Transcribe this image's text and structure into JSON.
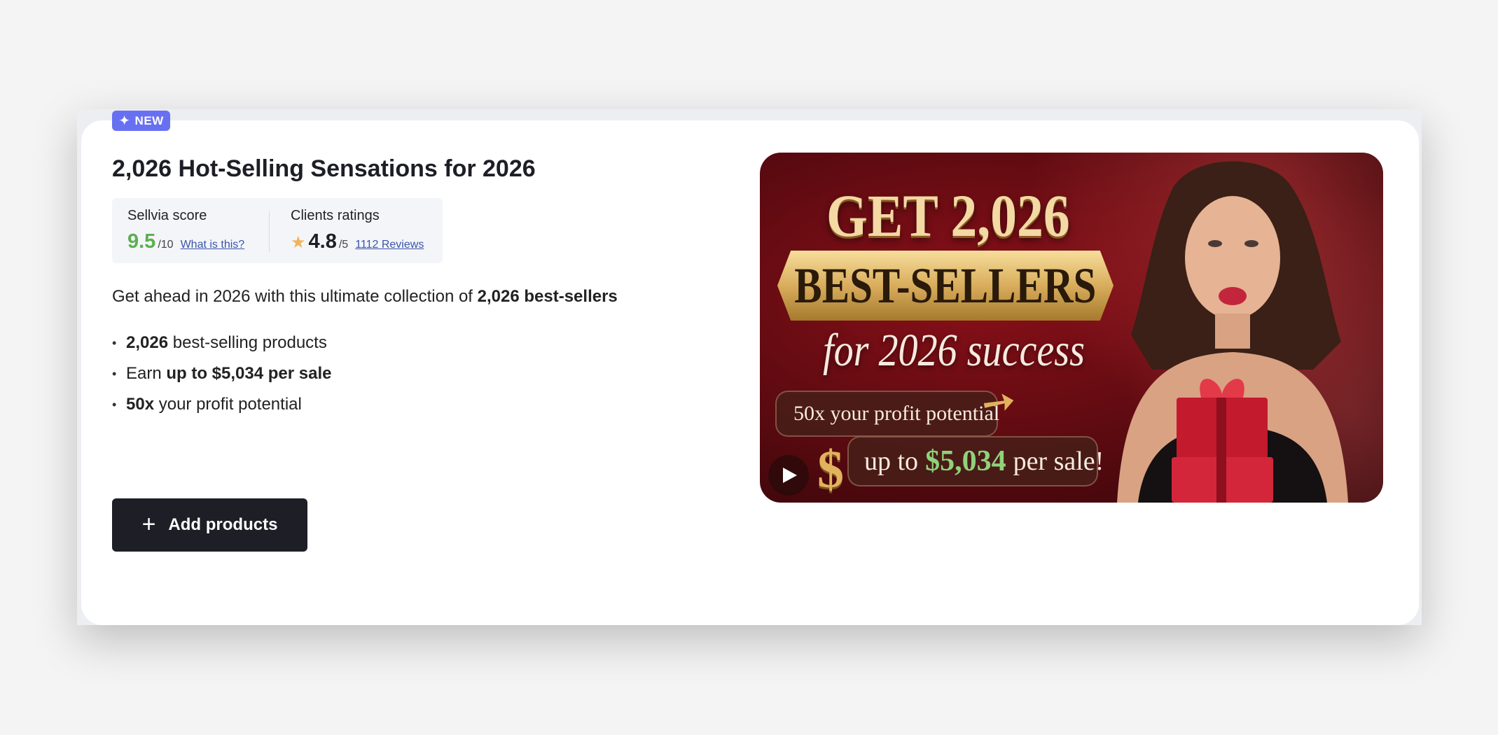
{
  "badge": {
    "label": "NEW"
  },
  "title": "2,026 Hot-Selling Sensations for 2026",
  "scores": {
    "sellvia": {
      "label": "Sellvia score",
      "value": "9.5",
      "out_of": "/10",
      "link": "What is this?"
    },
    "clients": {
      "label": "Clients ratings",
      "value": "4.8",
      "out_of": "/5",
      "link": "1112 Reviews"
    }
  },
  "description": {
    "prefix": "Get ahead in 2026 with this ultimate collection of ",
    "bold": "2,026 best-sellers"
  },
  "bullets": [
    {
      "bold": "2,026",
      "text": " best-selling products"
    },
    {
      "text": "Earn ",
      "bold": "up to $5,034 per sale"
    },
    {
      "bold": "50x",
      "text": " your profit potential"
    }
  ],
  "add_button": {
    "label": "Add products"
  },
  "banner": {
    "line1": "GET 2,026",
    "line2": "BEST-SELLERS",
    "line3": "for 2026 success",
    "pill1": "50x your profit potential",
    "pill2_prefix": "up to",
    "pill2_amount": "$5,034",
    "pill2_suffix": "per sale!",
    "dollar_sign": "$"
  },
  "colors": {
    "accent": "#6870f2",
    "score_green": "#5daf50",
    "star": "#f1b45a",
    "button_bg": "#1d1e26",
    "link": "#3b55a8"
  },
  "icons": {
    "badge": "plus-icon",
    "rating": "star-icon",
    "button": "plus-icon",
    "video": "play-icon"
  }
}
